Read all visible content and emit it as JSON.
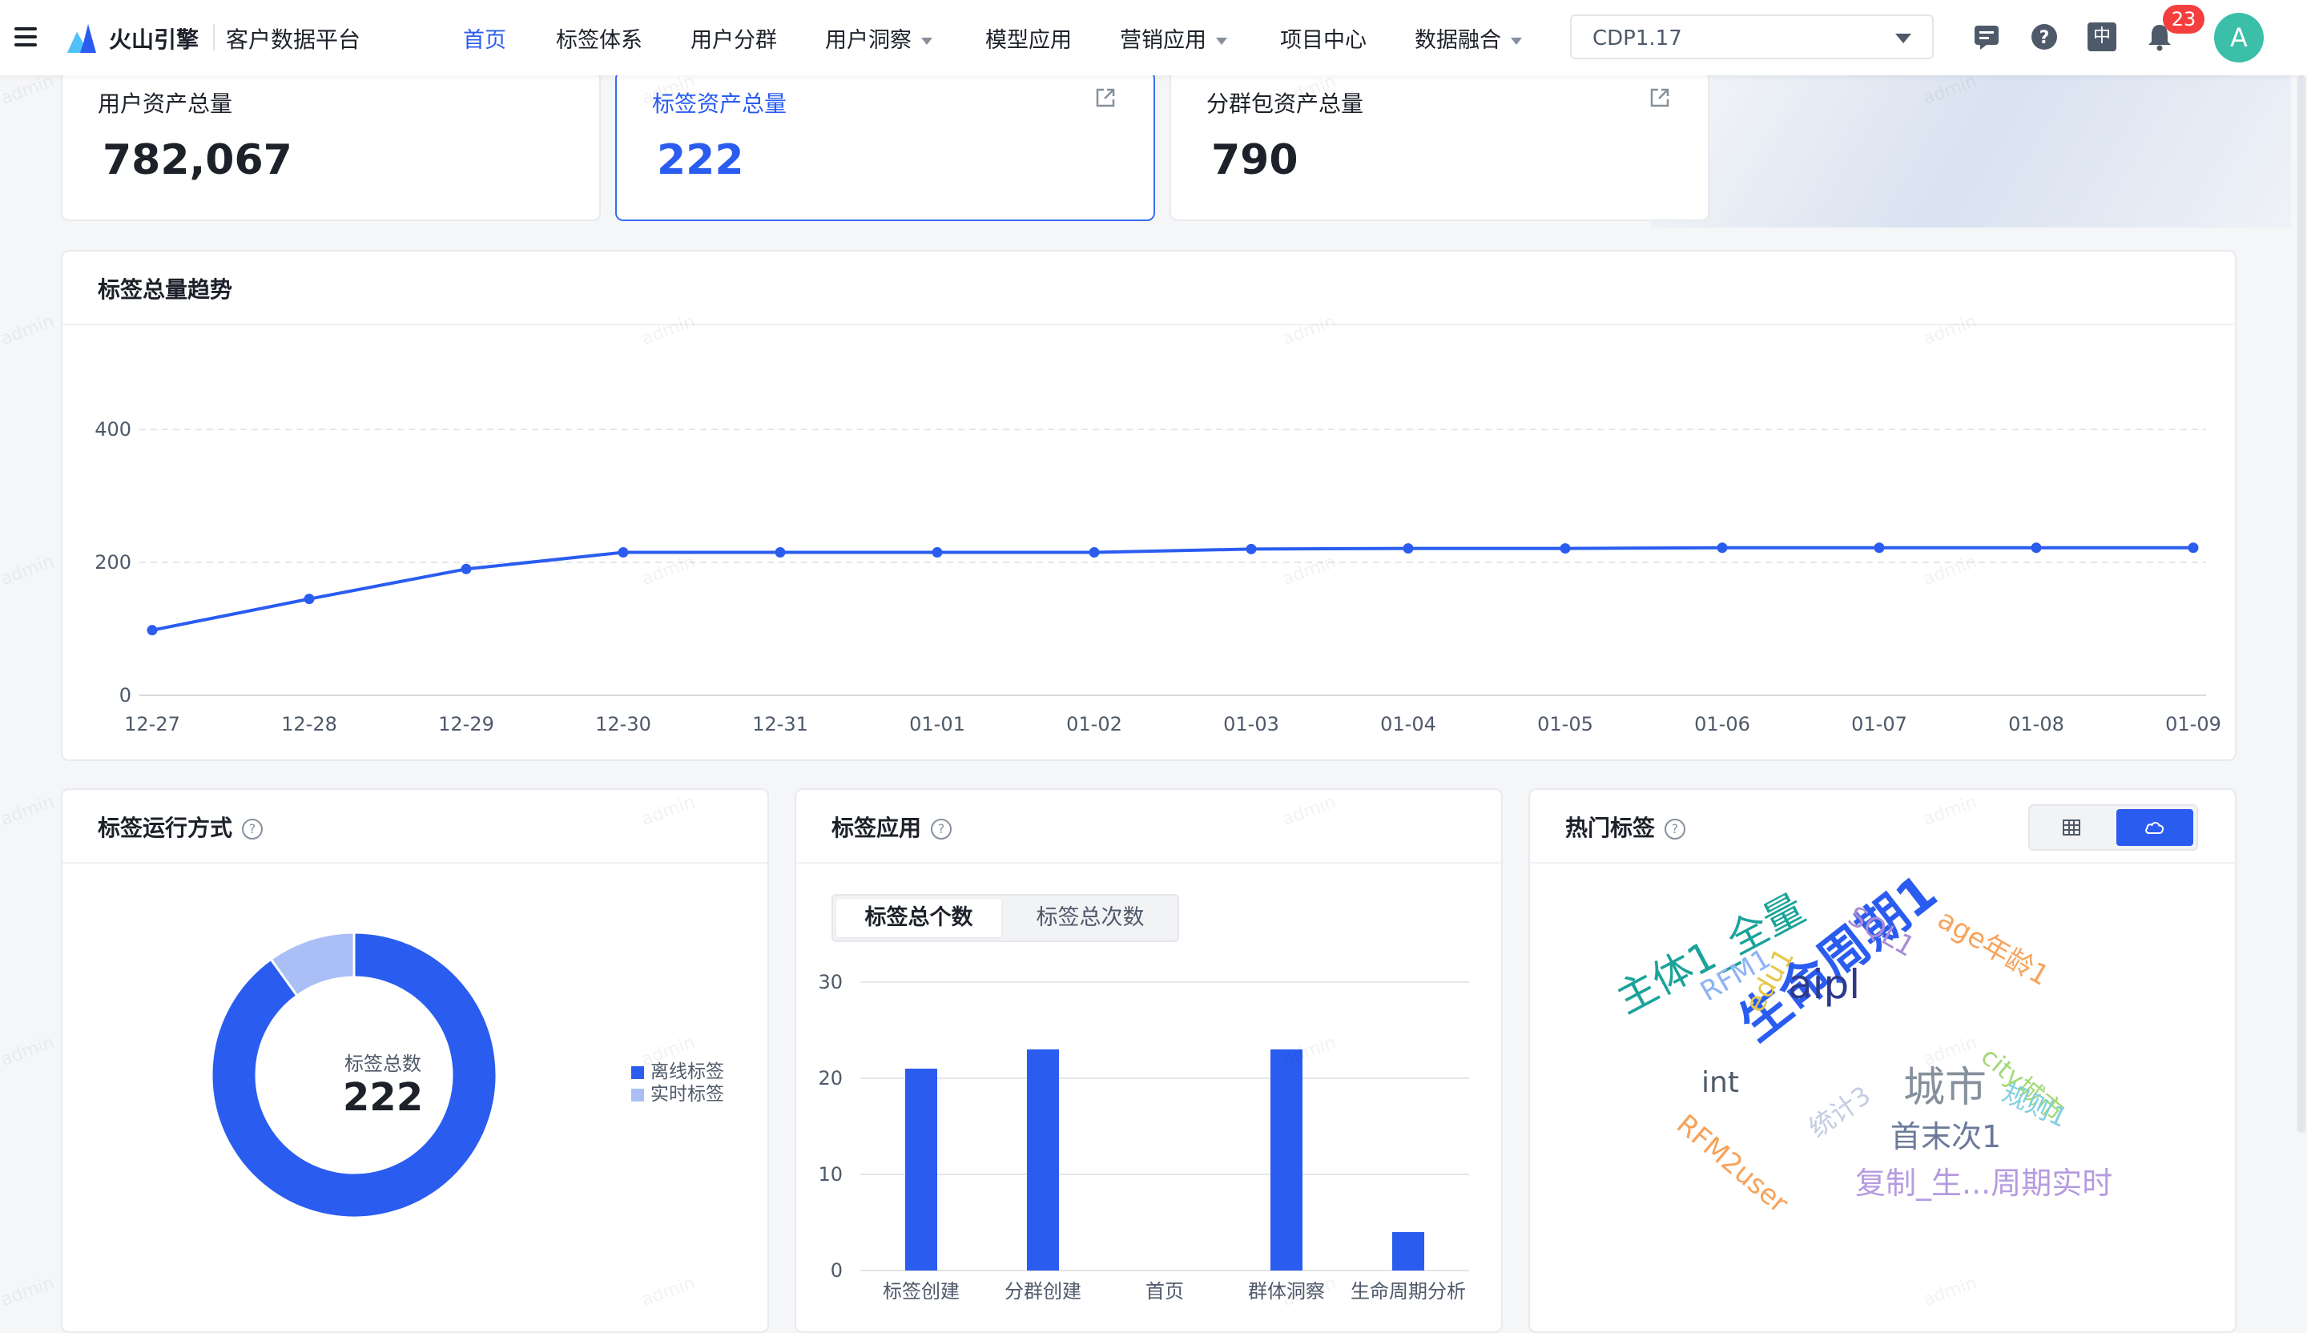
{
  "header": {
    "brand": "火山引擎",
    "product": "客户数据平台",
    "nav": [
      {
        "label": "首页",
        "active": true,
        "dropdown": false
      },
      {
        "label": "标签体系",
        "active": false,
        "dropdown": false
      },
      {
        "label": "用户分群",
        "active": false,
        "dropdown": false
      },
      {
        "label": "用户洞察",
        "active": false,
        "dropdown": true
      },
      {
        "label": "模型应用",
        "active": false,
        "dropdown": false
      },
      {
        "label": "营销应用",
        "active": false,
        "dropdown": true
      },
      {
        "label": "项目中心",
        "active": false,
        "dropdown": false
      },
      {
        "label": "数据融合",
        "active": false,
        "dropdown": true
      }
    ],
    "project": "CDP1.17",
    "icons": [
      "message-icon",
      "help-icon",
      "language-icon",
      "bell-icon"
    ],
    "language_label": "中",
    "notification_count": "23",
    "avatar": "A"
  },
  "kpis": [
    {
      "label": "用户资产总量",
      "value": "782,067",
      "selected": false,
      "external_link": false
    },
    {
      "label": "标签资产总量",
      "value": "222",
      "selected": true,
      "external_link": true
    },
    {
      "label": "分群包资产总量",
      "value": "790",
      "selected": false,
      "external_link": true
    }
  ],
  "trend": {
    "title": "标签总量趋势"
  },
  "run_mode": {
    "title": "标签运行方式",
    "center_label": "标签总数",
    "center_value": "222"
  },
  "tag_app": {
    "title": "标签应用",
    "tabs": [
      "标签总个数",
      "标签总次数"
    ]
  },
  "hot_tags": {
    "title": "热门标签",
    "view_icons": [
      "table-icon",
      "cloud-icon"
    ],
    "words": [
      {
        "text": "生命周期1",
        "color": "#2a5cf0"
      },
      {
        "text": "主体1_全量",
        "color": "#1aa39a"
      },
      {
        "text": "aipl",
        "color": "#2d3a8c"
      },
      {
        "text": "SQL1",
        "color": "#a98bd6"
      },
      {
        "text": "age年龄1",
        "color": "#f7a35c"
      },
      {
        "text": "RFM1",
        "color": "#8fb3f5"
      },
      {
        "text": "edu1",
        "color": "#e6c74a"
      },
      {
        "text": "int",
        "color": "#4e5969"
      },
      {
        "text": "城市",
        "color": "#86909c"
      },
      {
        "text": "city城市",
        "color": "#a3d977"
      },
      {
        "text": "规则1",
        "color": "#7ecfe0"
      },
      {
        "text": "统计3",
        "color": "#c4cde0"
      },
      {
        "text": "首末次1",
        "color": "#6b7a99"
      },
      {
        "text": "RFM2user",
        "color": "#f7a35c"
      },
      {
        "text": "复制_生...周期实时",
        "color": "#b59be0"
      }
    ]
  },
  "watermark": "admin",
  "chart_data": [
    {
      "type": "line",
      "title": "标签总量趋势",
      "x": [
        "12-27",
        "12-28",
        "12-29",
        "12-30",
        "12-31",
        "01-01",
        "01-02",
        "01-03",
        "01-04",
        "01-05",
        "01-06",
        "01-07",
        "01-08",
        "01-09"
      ],
      "series": [
        {
          "values": [
            98,
            145,
            190,
            215,
            215,
            215,
            215,
            220,
            221,
            221,
            222,
            222,
            222,
            222
          ],
          "color": "#2a5cf0"
        }
      ],
      "yticks": [
        0,
        200,
        400
      ],
      "ylim": [
        0,
        400
      ],
      "grid": true
    },
    {
      "type": "pie",
      "title": "标签运行方式",
      "slices": [
        {
          "label": "离线标签",
          "value": 200,
          "color": "#2a5cf0"
        },
        {
          "label": "实时标签",
          "value": 22,
          "color": "#a9bff5"
        }
      ],
      "legend": "right"
    },
    {
      "type": "bar",
      "title": "标签应用",
      "categories": [
        "标签创建",
        "分群创建",
        "首页",
        "群体洞察",
        "生命周期分析"
      ],
      "values": [
        21,
        23,
        0,
        23,
        4
      ],
      "yticks": [
        0,
        10,
        20,
        30
      ],
      "ylim": [
        0,
        30
      ],
      "color": "#2a5cf0"
    }
  ]
}
